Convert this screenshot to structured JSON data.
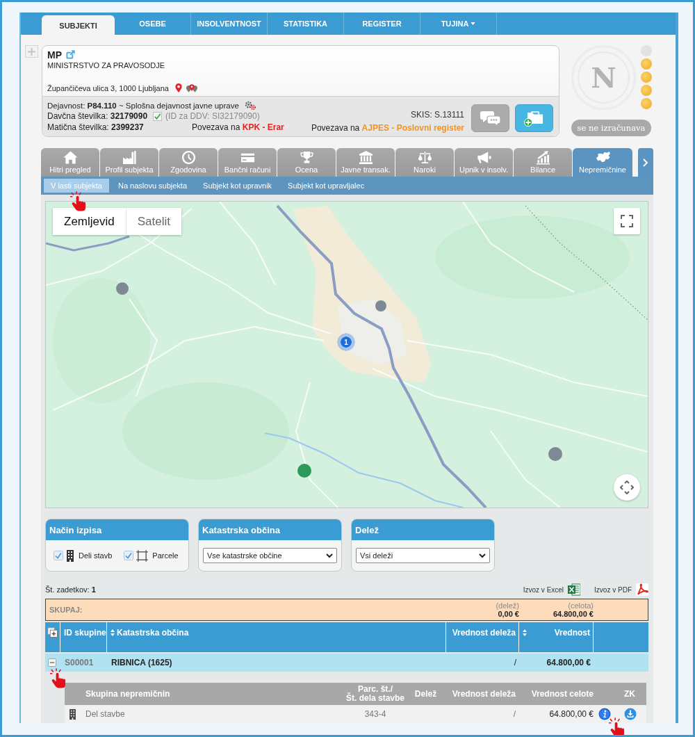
{
  "nav": [
    {
      "label": "SUBJEKTI",
      "selected": true,
      "dropdown": false
    },
    {
      "label": "OSEBE",
      "selected": false,
      "dropdown": false
    },
    {
      "label": "INSOLVENTNOST",
      "selected": false,
      "dropdown": false
    },
    {
      "label": "STATISTIKA",
      "selected": false,
      "dropdown": false
    },
    {
      "label": "REGISTER",
      "selected": false,
      "dropdown": false
    },
    {
      "label": "TUJINA",
      "selected": false,
      "dropdown": true
    }
  ],
  "subject": {
    "short_name": "MP",
    "name": "MINISTRSTVO ZA PRAVOSODJE",
    "address": "Župančičeva ulica 3, 1000 Ljubljana",
    "activity": "Dejavnost: **P84.110** ~ Splošna dejavnost javne uprave",
    "tax_number": "Davčna številka: **32179090**",
    "vat_verified": true,
    "vat_id": "(ID za DDV: SI32179090)",
    "registration_number": "Matična številka: **2399237**",
    "skis": "SKIS: S.13111",
    "links": [
      {
        "prefix": "Povezava na",
        "label": "KPK - Erar",
        "color": "#e8221b"
      },
      {
        "prefix": "Povezava na",
        "label": "AJPES - Poslovni register",
        "color": "#f39322"
      }
    ]
  },
  "rating": {
    "grade": "N",
    "coins": [
      {
        "filled": false
      },
      {
        "filled": true
      },
      {
        "filled": true
      },
      {
        "filled": true
      },
      {
        "filled": true
      }
    ],
    "status": "se ne izračunava"
  },
  "module_tabs": [
    {
      "label": "Hitri pregled",
      "selected": false
    },
    {
      "label": "Profil subjekta",
      "selected": false
    },
    {
      "label": "Zgodovina",
      "selected": false
    },
    {
      "label": "Bančni računi",
      "selected": false
    },
    {
      "label": "Ocena",
      "selected": false
    },
    {
      "label": "Javne transak.",
      "selected": false
    },
    {
      "label": "Naroki",
      "selected": false
    },
    {
      "label": "Upnik v insolv.",
      "selected": false
    },
    {
      "label": "Bilance",
      "selected": false
    },
    {
      "label": "Nepremičnine",
      "selected": true
    }
  ],
  "sub_tabs": [
    {
      "label": "V lasti subjekta",
      "selected": true
    },
    {
      "label": "Na naslovu subjekta",
      "selected": false
    },
    {
      "label": "Subjekt kot upravnik",
      "selected": false
    },
    {
      "label": "Subjekt kot upravljalec",
      "selected": false
    }
  ],
  "map": {
    "map_types": [
      {
        "label": "Zemljevid",
        "selected": true
      },
      {
        "label": "Satelit",
        "selected": false
      }
    ],
    "cluster_count": "1"
  },
  "filters": [
    {
      "title": "Način izpisa",
      "kind": "checkboxes",
      "options": [
        {
          "label": "Deli stavb",
          "checked": true
        },
        {
          "label": "Parcele",
          "checked": true
        }
      ]
    },
    {
      "title": "Katastrska občina",
      "kind": "select",
      "value": "Vse katastrske občine"
    },
    {
      "title": "Delež",
      "kind": "select",
      "value": "Vsi deleži"
    }
  ],
  "results": {
    "count": "Št. zadetkov: **1**",
    "exports": [
      {
        "label": "Izvoz v Excel",
        "kind": "excel"
      },
      {
        "label": "Izvoz v PDF",
        "kind": "pdf"
      }
    ]
  },
  "totals": {
    "label": "SKUPAJ:",
    "values": [
      {
        "caption": "(delež)",
        "value": "0,00 €"
      },
      {
        "caption": "(celota)",
        "value": "64.800,00 €"
      }
    ]
  },
  "table": {
    "columns": [
      {
        "label": "ID skupine",
        "sortable": false
      },
      {
        "label": "Katastrska občina",
        "sortable": true
      },
      {
        "label": "Vrednost deleža",
        "sortable": false
      },
      {
        "label": "Vrednost",
        "sortable": true
      }
    ],
    "rows": [
      {
        "expanded": true,
        "id": "S00001",
        "cadastral_municipality": "RIBNICA (1625)",
        "share_value": "/",
        "value": "64.800,00 €",
        "details": {
          "columns": [
            "Skupina nepremičnin",
            "Parc. št./\nŠt. dela stavbe",
            "Delež",
            "Vrednost deleža",
            "Vrednost celote",
            "ZK"
          ],
          "rows": [
            {
              "group": "Del stavbe",
              "parcel": "343-4",
              "share_value": "/",
              "total_value": "64.800,00 €"
            }
          ]
        }
      }
    ]
  }
}
